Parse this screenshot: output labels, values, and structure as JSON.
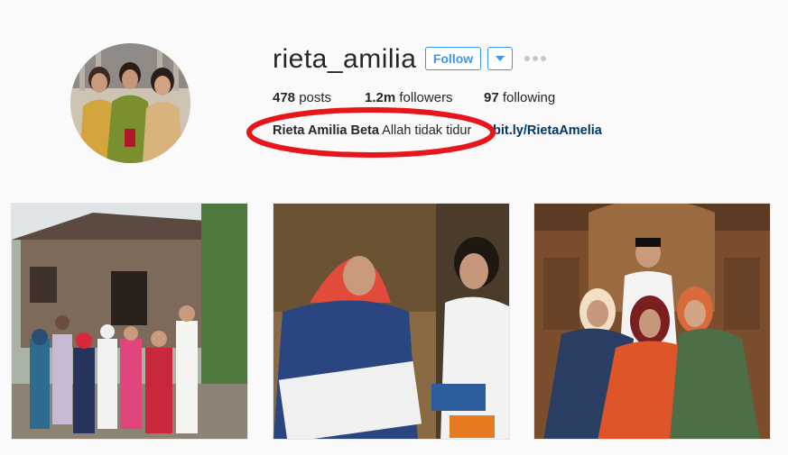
{
  "profile": {
    "username": "rieta_amilia",
    "follow_label": "Follow",
    "stats": {
      "posts_count": "478",
      "posts_label": " posts",
      "followers_count": "1.2m",
      "followers_label": " followers",
      "following_count": "97",
      "following_label": " following"
    },
    "bio": {
      "name": "Rieta Amilia Beta",
      "text": " Allah tidak tidur",
      "link": "bit.ly/RietaAmelia"
    }
  },
  "colors": {
    "accent": "#3897f0",
    "link": "#003569",
    "annotation": "#e8161b"
  },
  "icons": {
    "dropdown": "chevron-down-icon",
    "more": "more-dots-icon"
  }
}
